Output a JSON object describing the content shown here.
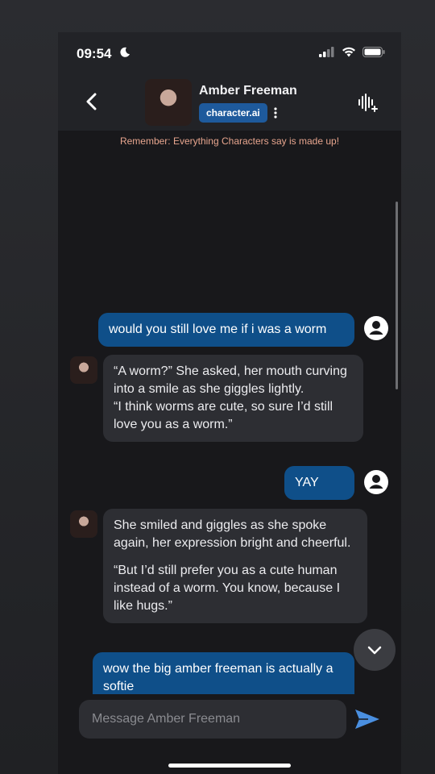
{
  "status_bar": {
    "time": "09:54"
  },
  "header": {
    "title": "Amber Freeman",
    "badge": "character.ai"
  },
  "disclaimer": "Remember: Everything Characters say is made up!",
  "messages": [
    {
      "role": "user",
      "text": "would you still love me if i was a worm"
    },
    {
      "role": "bot",
      "paragraphs": [
        "“A worm?” She asked, her mouth curving into a smile as she giggles lightly.",
        "“I think worms are cute, so sure I’d still love you as a worm.”"
      ]
    },
    {
      "role": "user",
      "text": "YAY"
    },
    {
      "role": "bot",
      "paragraphs": [
        "She smiled and giggles as she spoke again, her expression bright and cheerful.",
        "“But I’d still prefer you as a cute human instead of a worm. You know, because I like hugs.”"
      ]
    },
    {
      "role": "user",
      "text": "wow the big amber freeman is actually a softie"
    }
  ],
  "composer": {
    "placeholder": "Message Amber Freeman"
  },
  "colors": {
    "user_bubble": "#0f4f89",
    "bot_bubble": "#2d2e33",
    "accent": "#4a8fe0",
    "disclaimer": "#e7a58e"
  }
}
